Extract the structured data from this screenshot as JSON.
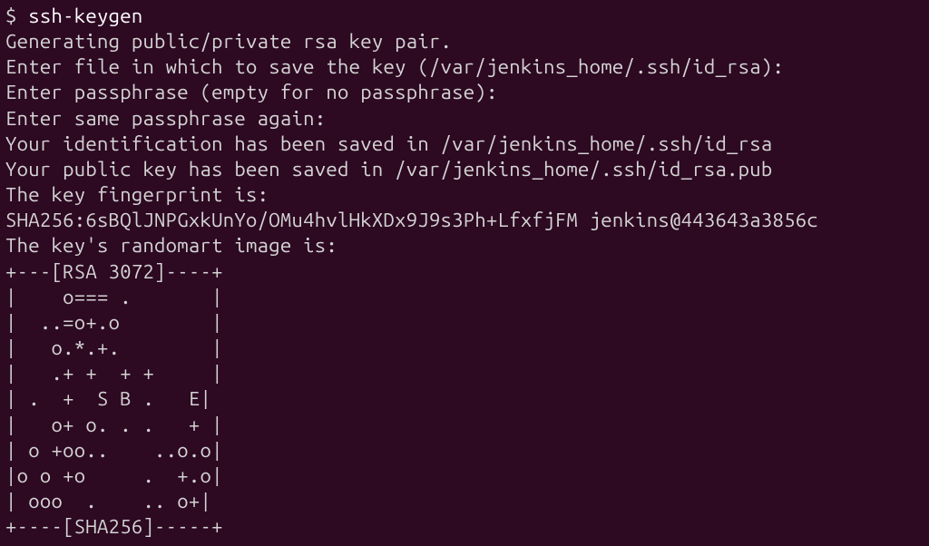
{
  "prompt": "$ ",
  "command": "ssh-keygen",
  "lines": [
    "Generating public/private rsa key pair.",
    "Enter file in which to save the key (/var/jenkins_home/.ssh/id_rsa):",
    "Enter passphrase (empty for no passphrase):",
    "Enter same passphrase again:",
    "Your identification has been saved in /var/jenkins_home/.ssh/id_rsa",
    "Your public key has been saved in /var/jenkins_home/.ssh/id_rsa.pub",
    "The key fingerprint is:",
    "SHA256:6sBQlJNPGxkUnYo/OMu4hvlHkXDx9J9s3Ph+LfxfjFM jenkins@443643a3856c",
    "The key's randomart image is:",
    "+---[RSA 3072]----+",
    "|    o=== .       |",
    "|  ..=o+.o        |",
    "|   o.*.+.        |",
    "|   .+ +  + +     |",
    "| .  +  S B .   E|",
    "|   o+ o. . .   + |",
    "| o +oo..    ..o.o|",
    "|o o +o     .  +.o|",
    "| ooo  .    .. o+|",
    "+----[SHA256]-----+"
  ]
}
